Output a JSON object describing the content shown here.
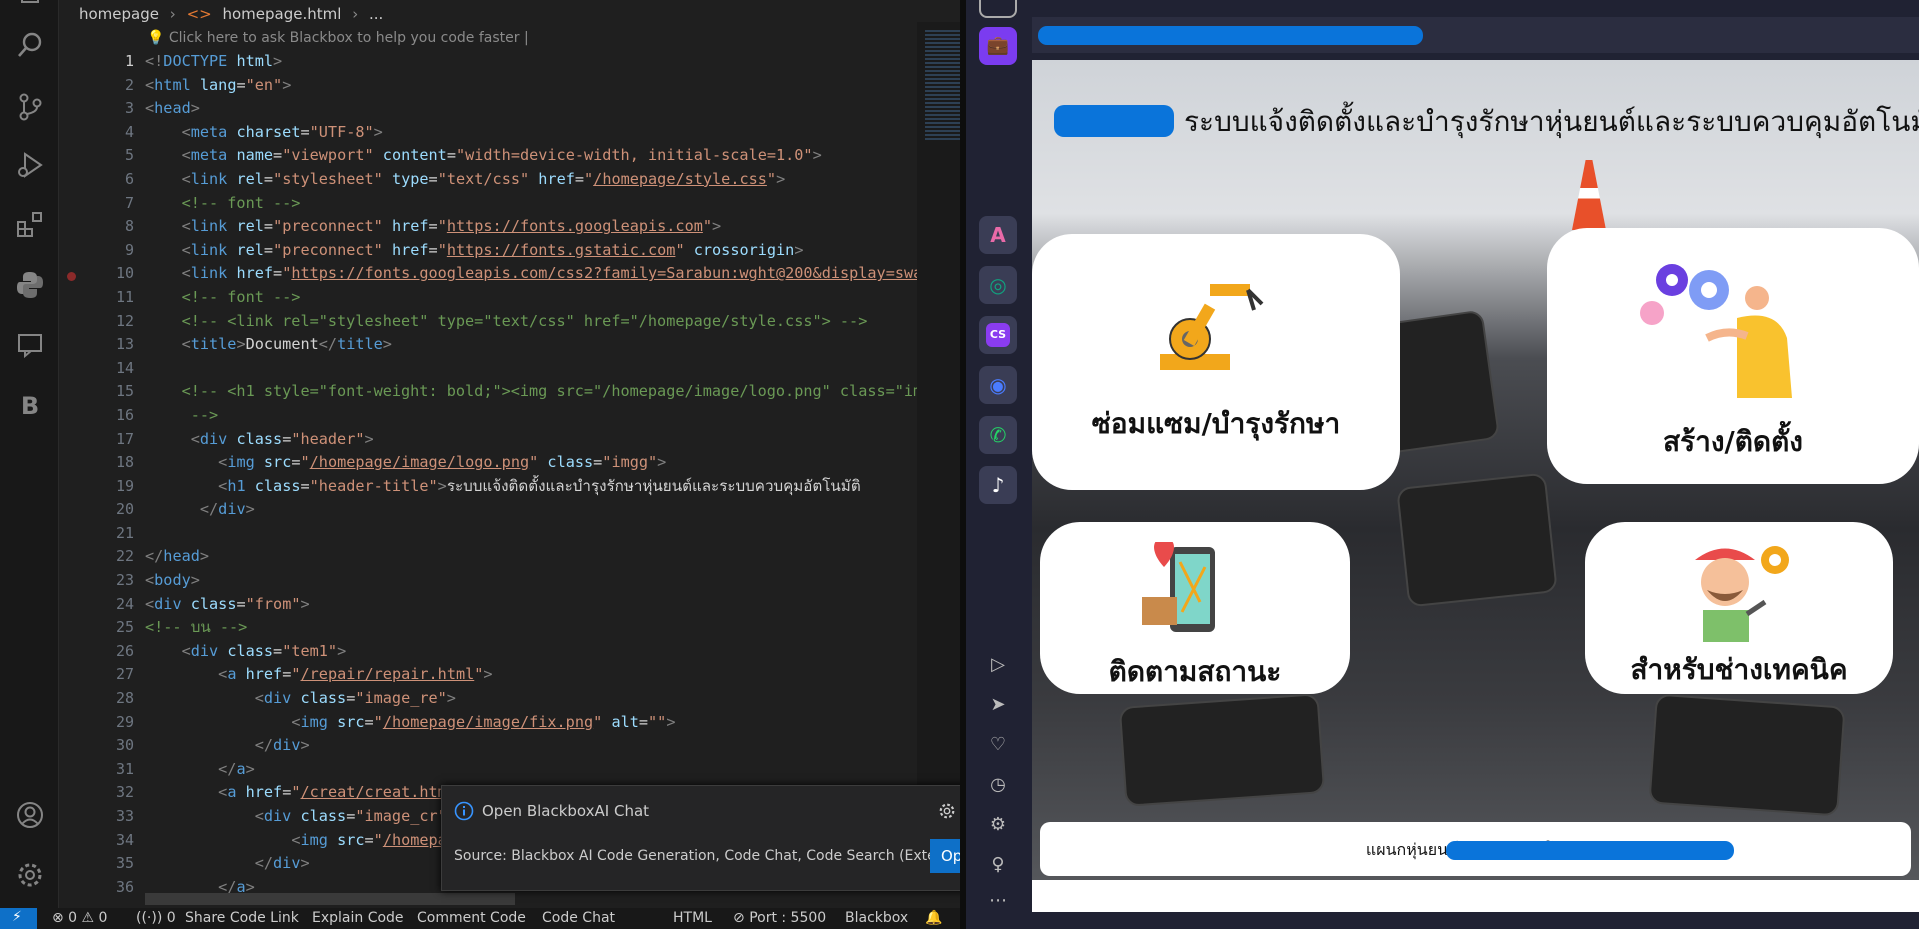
{
  "editor": {
    "breadcrumb": [
      "homepage",
      "homepage.html",
      "..."
    ],
    "hint": "Click here to ask Blackbox to help you code faster |",
    "active_line": 1,
    "line_numbers": [
      "1",
      "2",
      "3",
      "4",
      "5",
      "6",
      "7",
      "8",
      "9",
      "10",
      "11",
      "12",
      "13",
      "14",
      "15",
      "16",
      "17",
      "18",
      "19",
      "20",
      "21",
      "22",
      "23",
      "24",
      "25",
      "26",
      "27",
      "28",
      "29",
      "30",
      "31",
      "32",
      "33",
      "34",
      "35",
      "36"
    ]
  },
  "notification": {
    "title": "Open BlackboxAI Chat",
    "source": "Source: Blackbox AI Code Generation, Code Chat, Code Search (Exte...",
    "open_label": "Open"
  },
  "statusbar": {
    "problems": "⊗ 0 ⚠ 0",
    "ports": "0",
    "share": "Share Code Link",
    "explain": "Explain Code",
    "comment": "Comment Code",
    "chat": "Code Chat",
    "language": "HTML",
    "port": "Port : 5500",
    "blackbox": "Blackbox"
  },
  "browser": {
    "header_title": "ระบบแจ้งติดตั้งและบำรุงรักษาหุ่นยนต์และระบบควบคุมอัตโนมัติ",
    "cards": [
      {
        "label": "ซ่อมแซม/บำรุงรักษา"
      },
      {
        "label": "สร้าง/ติดตั้ง"
      },
      {
        "label": "ติดตามสถานะ"
      },
      {
        "label": "สำหรับช่างเทคนิค"
      }
    ],
    "footer_text": "แผนกหุ่นยนต์และระบบอัตโนมัติ"
  },
  "colors": {
    "accent": "#0e70c8",
    "sidebar": "#202233",
    "redaction": "#0a74da"
  }
}
